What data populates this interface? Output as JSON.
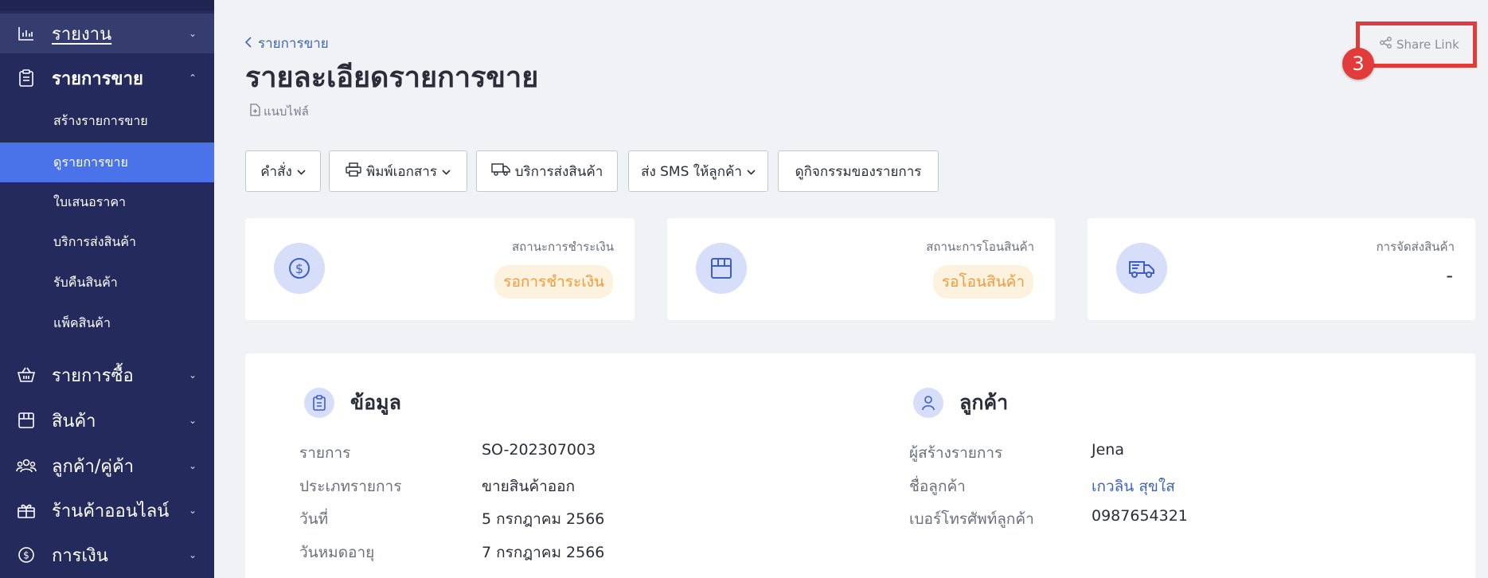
{
  "sidebar": {
    "items": [
      {
        "label": "รายงาน",
        "icon": "bar-chart-icon",
        "chevron": "⌄"
      },
      {
        "label": "รายการขาย",
        "icon": "clipboard-icon",
        "chevron": "⌃"
      },
      {
        "label": "รายการซื้อ",
        "icon": "basket-icon",
        "chevron": "⌄"
      },
      {
        "label": "สินค้า",
        "icon": "box-icon",
        "chevron": "⌄"
      },
      {
        "label": "ลูกค้า/คู่ค้า",
        "icon": "users-icon",
        "chevron": "⌄"
      },
      {
        "label": "ร้านค้าออนไลน์",
        "icon": "gift-shop-icon",
        "chevron": "⌄"
      },
      {
        "label": "การเงิน",
        "icon": "dollar-icon",
        "chevron": "⌄"
      }
    ],
    "sub_items": [
      {
        "label": "สร้างรายการขาย"
      },
      {
        "label": "ดูรายการขาย",
        "active": true
      },
      {
        "label": "ใบเสนอราคา"
      },
      {
        "label": "บริการส่งสินค้า"
      },
      {
        "label": "รับคืนสินค้า"
      },
      {
        "label": "แพ็คสินค้า"
      }
    ]
  },
  "header": {
    "breadcrumb": "รายการขาย",
    "title": "รายละเอียดรายการขาย",
    "attach_label": "แนบไฟล์",
    "share_label": "Share Link",
    "step_number": "3"
  },
  "toolbar": {
    "command": "คำสั่ง",
    "print": "พิมพ์เอกสาร",
    "shipping": "บริการส่งสินค้า",
    "sms": "ส่ง SMS ให้ลูกค้า",
    "activity": "ดูกิจกรรมของรายการ"
  },
  "status": {
    "payment_caption": "สถานะการชำระเงิน",
    "payment_value": "รอการชำระเงิน",
    "transfer_caption": "สถานะการโอนสินค้า",
    "transfer_value": "รอโอนสินค้า",
    "delivery_caption": "การจัดส่งสินค้า",
    "delivery_value": "-"
  },
  "info": {
    "title": "ข้อมูล",
    "rows": [
      {
        "label": "รายการ",
        "value": "SO-202307003"
      },
      {
        "label": "ประเภทรายการ",
        "value": "ขายสินค้าออก"
      },
      {
        "label": "วันที่",
        "value": "5 กรกฎาคม 2566"
      },
      {
        "label": "วันหมดอายุ",
        "value": "7 กรกฎาคม 2566"
      }
    ]
  },
  "customer": {
    "title": "ลูกค้า",
    "rows": [
      {
        "label": "ผู้สร้างรายการ",
        "value": "Jena"
      },
      {
        "label": "ชื่อลูกค้า",
        "value": "เกวลิน สุขใส"
      },
      {
        "label": "เบอร์โทรศัพท์ลูกค้า",
        "value": "0987654321"
      }
    ]
  },
  "colors": {
    "sidebar_bg": "#242a5c",
    "active_item": "#4a73ea",
    "accent_blue": "#3d65b8",
    "pending_orange": "#f29a3d",
    "highlight_red": "#e23b3b"
  }
}
